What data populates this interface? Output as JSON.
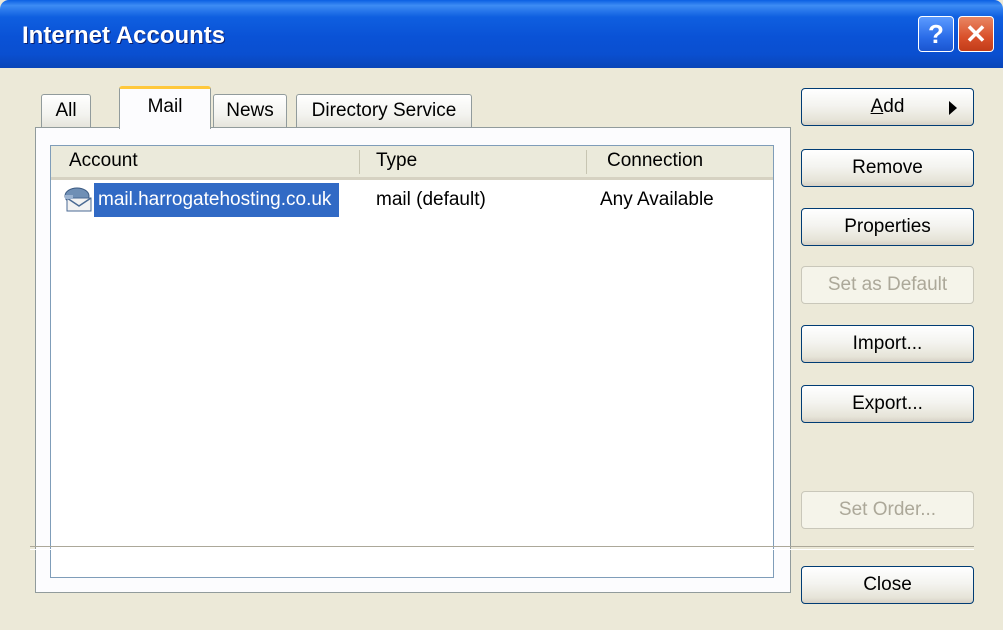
{
  "window": {
    "title": "Internet Accounts"
  },
  "titlebar": {
    "help_glyph": "?",
    "close_glyph": "✕"
  },
  "tabs": [
    {
      "label": "All"
    },
    {
      "label": "Mail"
    },
    {
      "label": "News"
    },
    {
      "label": "Directory Service"
    }
  ],
  "table": {
    "columns": [
      "Account",
      "Type",
      "Connection"
    ],
    "rows": [
      {
        "account": "mail.harrogatehosting.co.uk",
        "type": "mail (default)",
        "connection": "Any Available",
        "icon": "mail-account-icon",
        "selected": true
      }
    ]
  },
  "buttons": {
    "add": {
      "label_ul": "A",
      "label_rest": "dd"
    },
    "remove": "Remove",
    "properties": "Properties",
    "set_default": "Set as Default",
    "import": "Import...",
    "export": "Export...",
    "set_order": "Set Order...",
    "close": "Close"
  },
  "colors": {
    "selection": "#316ac5",
    "titlebar": "#0a52d6",
    "active_tab_accent": "#ffc83c"
  }
}
